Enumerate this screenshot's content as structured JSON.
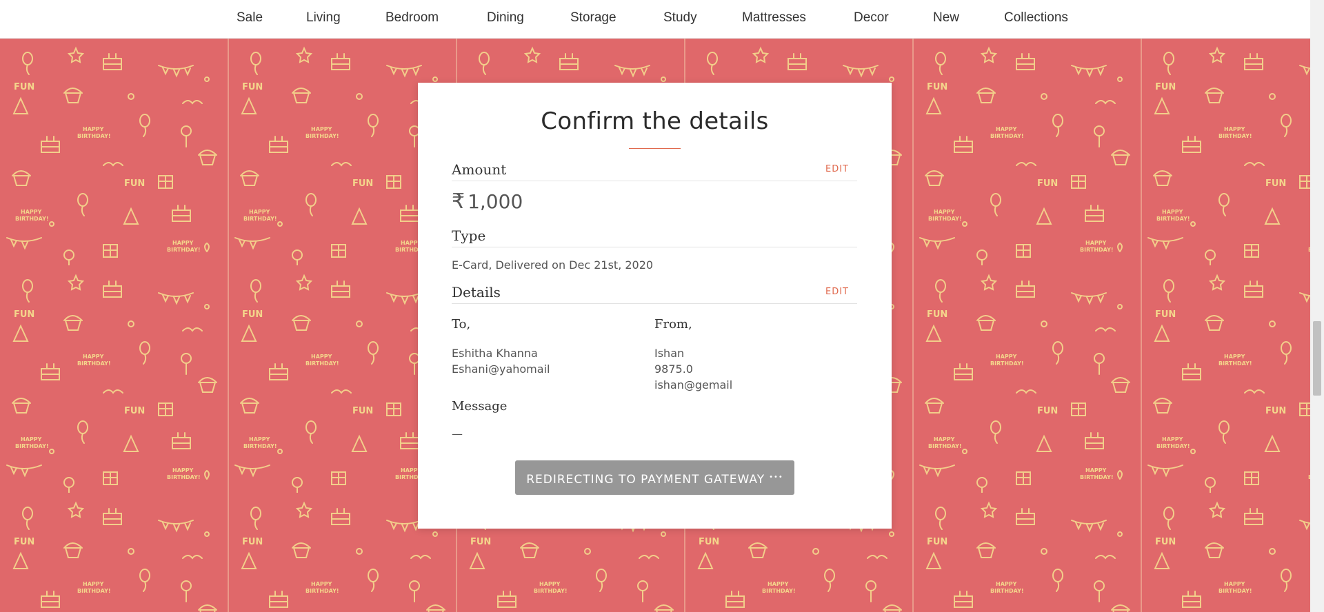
{
  "nav": {
    "items": [
      {
        "label": "Sale"
      },
      {
        "label": "Living"
      },
      {
        "label": "Bedroom"
      },
      {
        "label": "Dining"
      },
      {
        "label": "Storage"
      },
      {
        "label": "Study"
      },
      {
        "label": "Mattresses"
      },
      {
        "label": "Decor"
      },
      {
        "label": "New"
      },
      {
        "label": "Collections"
      }
    ]
  },
  "background": {
    "pattern_color": "#e0686a",
    "doodle_color": "#f6e18f",
    "doodle_texts": [
      "FUN",
      "HAPPY",
      "BIRTHDAY!"
    ]
  },
  "card": {
    "title": "Confirm the details",
    "amount_section": {
      "label": "Amount",
      "edit_label": "EDIT"
    },
    "amount": {
      "currency_symbol": "₹",
      "value": "1,000"
    },
    "type_section": {
      "label": "Type"
    },
    "type_value": "E-Card, Delivered on Dec 21st, 2020",
    "details_section": {
      "label": "Details",
      "edit_label": "EDIT"
    },
    "to": {
      "label": "To,",
      "name": "Eshitha Khanna",
      "email": "Eshani@yahomail"
    },
    "from": {
      "label": "From,",
      "name": "Ishan",
      "phone": "9875.0",
      "email": "ishan@gemail"
    },
    "message": {
      "label": "Message",
      "value": "—"
    },
    "pay_button": {
      "label": "REDIRECTING TO PAYMENT GATEWAY",
      "spinner": "•••"
    }
  },
  "colors": {
    "accent": "#e0694d",
    "button": "#979797"
  }
}
